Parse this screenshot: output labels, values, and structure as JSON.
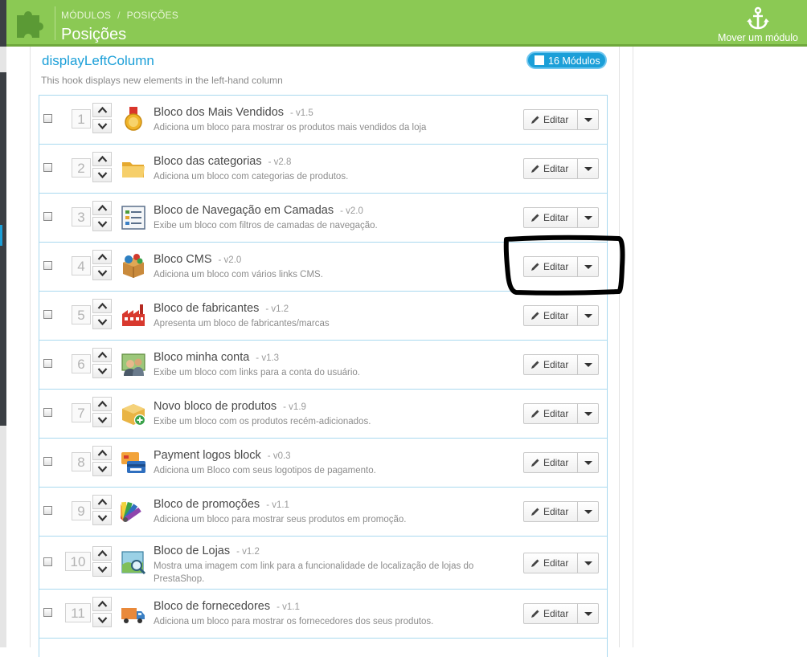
{
  "header": {
    "breadcrumb": [
      "MÓDULOS",
      "POSIÇÕES"
    ],
    "title": "Posições",
    "move_module_label": "Mover um módulo",
    "accent_color": "#8bc954"
  },
  "hook": {
    "title": "displayLeftColumn",
    "description": "This hook displays new elements in the left-hand column",
    "modules_count_label": "16 Módulos",
    "badge_color": "#1b9fd8"
  },
  "edit_label": "Editar",
  "modules": [
    {
      "position": "1",
      "name": "Bloco dos Mais Vendidos",
      "version": "- v1.5",
      "description": "Adiciona um bloco para mostrar os produtos mais vendidos da loja",
      "icon": "medal-icon"
    },
    {
      "position": "2",
      "name": "Bloco das categorias",
      "version": "- v2.8",
      "description": "Adiciona um bloco com categorias de produtos.",
      "icon": "folder-icon"
    },
    {
      "position": "3",
      "name": "Bloco de Navegação em Camadas",
      "version": "- v2.0",
      "description": "Exibe um bloco com filtros de camadas de navegação.",
      "icon": "filter-list-icon"
    },
    {
      "position": "4",
      "name": "Bloco CMS",
      "version": "- v2.0",
      "description": "Adiciona um bloco com vários links CMS.",
      "icon": "cms-box-icon"
    },
    {
      "position": "5",
      "name": "Bloco de fabricantes",
      "version": "- v1.2",
      "description": "Apresenta um bloco de fabricantes/marcas",
      "icon": "factory-icon"
    },
    {
      "position": "6",
      "name": "Bloco minha conta",
      "version": "- v1.3",
      "description": "Exibe um bloco com links para a conta do usuário.",
      "icon": "users-icon"
    },
    {
      "position": "7",
      "name": "Novo bloco de produtos",
      "version": "- v1.9",
      "description": "Exibe um bloco com os produtos recém-adicionados.",
      "icon": "new-box-icon"
    },
    {
      "position": "8",
      "name": "Payment logos block",
      "version": "- v0.3",
      "description": "Adiciona um Bloco com seus logotipos de pagamento.",
      "icon": "credit-card-icon"
    },
    {
      "position": "9",
      "name": "Bloco de promoções",
      "version": "- v1.1",
      "description": "Adiciona um bloco para mostrar seus produtos em promoção.",
      "icon": "color-swatch-icon"
    },
    {
      "position": "10",
      "name": "Bloco de Lojas",
      "version": "- v1.2",
      "description": "Mostra uma imagem com link para a funcionalidade de localização de lojas do PrestaShop.",
      "icon": "map-search-icon"
    },
    {
      "position": "11",
      "name": "Bloco de fornecedores",
      "version": "- v1.1",
      "description": "Adiciona um bloco para mostrar os fornecedores dos seus produtos.",
      "icon": "truck-icon"
    }
  ]
}
